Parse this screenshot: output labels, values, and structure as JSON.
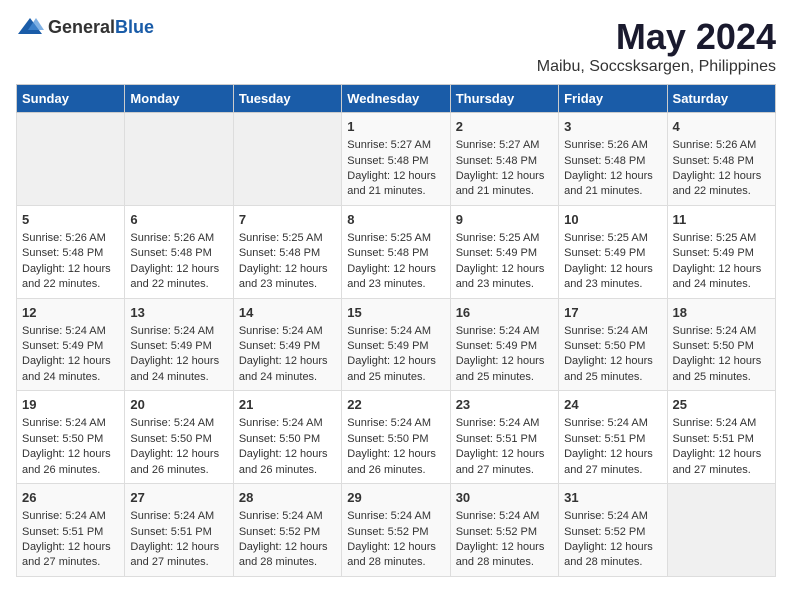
{
  "logo": {
    "text_general": "General",
    "text_blue": "Blue"
  },
  "header": {
    "main_title": "May 2024",
    "subtitle": "Maibu, Soccsksargen, Philippines"
  },
  "days_of_week": [
    "Sunday",
    "Monday",
    "Tuesday",
    "Wednesday",
    "Thursday",
    "Friday",
    "Saturday"
  ],
  "weeks": [
    {
      "days": [
        {
          "number": "",
          "info": ""
        },
        {
          "number": "",
          "info": ""
        },
        {
          "number": "",
          "info": ""
        },
        {
          "number": "1",
          "info": "Sunrise: 5:27 AM\nSunset: 5:48 PM\nDaylight: 12 hours\nand 21 minutes."
        },
        {
          "number": "2",
          "info": "Sunrise: 5:27 AM\nSunset: 5:48 PM\nDaylight: 12 hours\nand 21 minutes."
        },
        {
          "number": "3",
          "info": "Sunrise: 5:26 AM\nSunset: 5:48 PM\nDaylight: 12 hours\nand 21 minutes."
        },
        {
          "number": "4",
          "info": "Sunrise: 5:26 AM\nSunset: 5:48 PM\nDaylight: 12 hours\nand 22 minutes."
        }
      ]
    },
    {
      "days": [
        {
          "number": "5",
          "info": "Sunrise: 5:26 AM\nSunset: 5:48 PM\nDaylight: 12 hours\nand 22 minutes."
        },
        {
          "number": "6",
          "info": "Sunrise: 5:26 AM\nSunset: 5:48 PM\nDaylight: 12 hours\nand 22 minutes."
        },
        {
          "number": "7",
          "info": "Sunrise: 5:25 AM\nSunset: 5:48 PM\nDaylight: 12 hours\nand 23 minutes."
        },
        {
          "number": "8",
          "info": "Sunrise: 5:25 AM\nSunset: 5:48 PM\nDaylight: 12 hours\nand 23 minutes."
        },
        {
          "number": "9",
          "info": "Sunrise: 5:25 AM\nSunset: 5:49 PM\nDaylight: 12 hours\nand 23 minutes."
        },
        {
          "number": "10",
          "info": "Sunrise: 5:25 AM\nSunset: 5:49 PM\nDaylight: 12 hours\nand 23 minutes."
        },
        {
          "number": "11",
          "info": "Sunrise: 5:25 AM\nSunset: 5:49 PM\nDaylight: 12 hours\nand 24 minutes."
        }
      ]
    },
    {
      "days": [
        {
          "number": "12",
          "info": "Sunrise: 5:24 AM\nSunset: 5:49 PM\nDaylight: 12 hours\nand 24 minutes."
        },
        {
          "number": "13",
          "info": "Sunrise: 5:24 AM\nSunset: 5:49 PM\nDaylight: 12 hours\nand 24 minutes."
        },
        {
          "number": "14",
          "info": "Sunrise: 5:24 AM\nSunset: 5:49 PM\nDaylight: 12 hours\nand 24 minutes."
        },
        {
          "number": "15",
          "info": "Sunrise: 5:24 AM\nSunset: 5:49 PM\nDaylight: 12 hours\nand 25 minutes."
        },
        {
          "number": "16",
          "info": "Sunrise: 5:24 AM\nSunset: 5:49 PM\nDaylight: 12 hours\nand 25 minutes."
        },
        {
          "number": "17",
          "info": "Sunrise: 5:24 AM\nSunset: 5:50 PM\nDaylight: 12 hours\nand 25 minutes."
        },
        {
          "number": "18",
          "info": "Sunrise: 5:24 AM\nSunset: 5:50 PM\nDaylight: 12 hours\nand 25 minutes."
        }
      ]
    },
    {
      "days": [
        {
          "number": "19",
          "info": "Sunrise: 5:24 AM\nSunset: 5:50 PM\nDaylight: 12 hours\nand 26 minutes."
        },
        {
          "number": "20",
          "info": "Sunrise: 5:24 AM\nSunset: 5:50 PM\nDaylight: 12 hours\nand 26 minutes."
        },
        {
          "number": "21",
          "info": "Sunrise: 5:24 AM\nSunset: 5:50 PM\nDaylight: 12 hours\nand 26 minutes."
        },
        {
          "number": "22",
          "info": "Sunrise: 5:24 AM\nSunset: 5:50 PM\nDaylight: 12 hours\nand 26 minutes."
        },
        {
          "number": "23",
          "info": "Sunrise: 5:24 AM\nSunset: 5:51 PM\nDaylight: 12 hours\nand 27 minutes."
        },
        {
          "number": "24",
          "info": "Sunrise: 5:24 AM\nSunset: 5:51 PM\nDaylight: 12 hours\nand 27 minutes."
        },
        {
          "number": "25",
          "info": "Sunrise: 5:24 AM\nSunset: 5:51 PM\nDaylight: 12 hours\nand 27 minutes."
        }
      ]
    },
    {
      "days": [
        {
          "number": "26",
          "info": "Sunrise: 5:24 AM\nSunset: 5:51 PM\nDaylight: 12 hours\nand 27 minutes."
        },
        {
          "number": "27",
          "info": "Sunrise: 5:24 AM\nSunset: 5:51 PM\nDaylight: 12 hours\nand 27 minutes."
        },
        {
          "number": "28",
          "info": "Sunrise: 5:24 AM\nSunset: 5:52 PM\nDaylight: 12 hours\nand 28 minutes."
        },
        {
          "number": "29",
          "info": "Sunrise: 5:24 AM\nSunset: 5:52 PM\nDaylight: 12 hours\nand 28 minutes."
        },
        {
          "number": "30",
          "info": "Sunrise: 5:24 AM\nSunset: 5:52 PM\nDaylight: 12 hours\nand 28 minutes."
        },
        {
          "number": "31",
          "info": "Sunrise: 5:24 AM\nSunset: 5:52 PM\nDaylight: 12 hours\nand 28 minutes."
        },
        {
          "number": "",
          "info": ""
        }
      ]
    }
  ]
}
